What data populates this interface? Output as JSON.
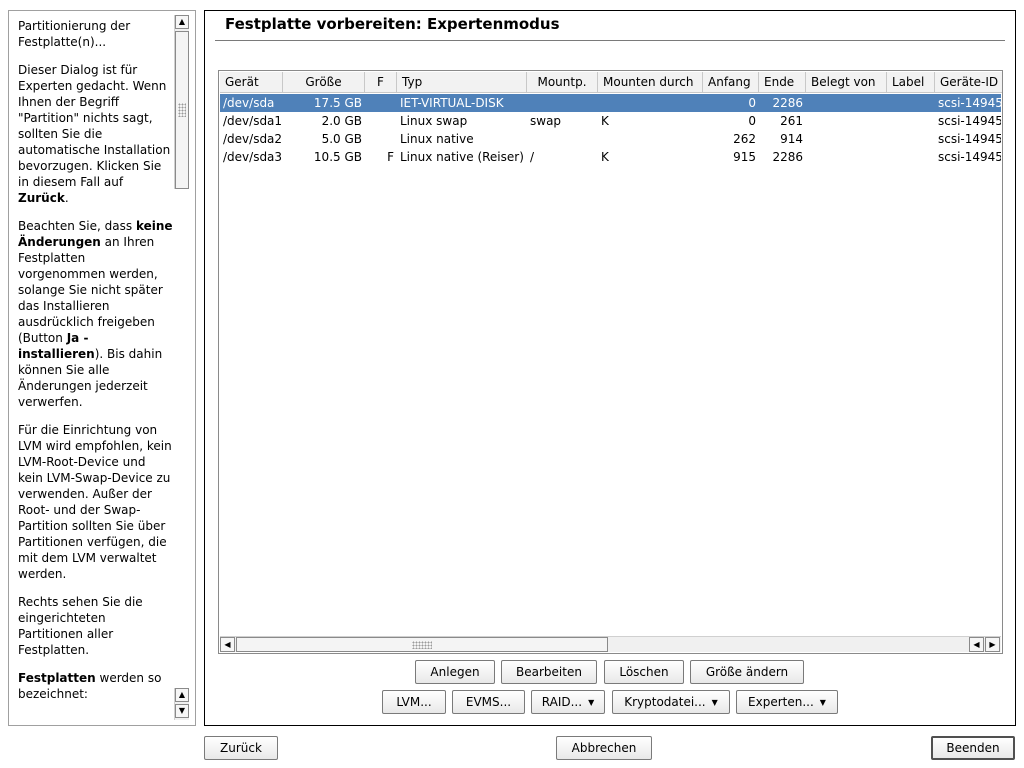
{
  "help": {
    "p1": "Partitionierung der Festplatte(n)...",
    "p2": "Dieser Dialog ist für Experten gedacht. Wenn Ihnen der Begriff \"Partition\" nichts sagt, sollten Sie die automatische Installation bevorzugen. Klicken Sie in diesem Fall auf ",
    "p2_bold": "Zurück",
    "p2_end": ".",
    "p3a": "Beachten Sie, dass ",
    "p3_bold1": "keine Änderungen",
    "p3b": " an Ihren Festplatten vorgenommen werden, solange Sie nicht später das Installieren ausdrücklich freigeben (Button ",
    "p3_bold2": "Ja - installieren",
    "p3c": "). Bis dahin können Sie alle Änderungen jederzeit verwerfen.",
    "p4": "Für die Einrichtung von LVM wird empfohlen, kein LVM-Root-Device und kein LVM-Swap-Device zu verwenden. Außer der Root- und der Swap-Partition sollten Sie über Partitionen verfügen, die mit dem LVM verwaltet werden.",
    "p5": "Rechts sehen Sie die eingerichteten Partitionen aller Festplatten.",
    "p6_bold": "Festplatten",
    "p6": " werden so bezeichnet:"
  },
  "main": {
    "title": "Festplatte vorbereiten: Expertenmodus"
  },
  "table": {
    "columns": [
      "Gerät",
      "Größe",
      "F",
      "Typ",
      "Mountp.",
      "Mounten durch",
      "Anfang",
      "Ende",
      "Belegt von",
      "Label",
      "Geräte-ID"
    ],
    "rows": [
      [
        "/dev/sda",
        "17.5 GB",
        "",
        "IET-VIRTUAL-DISK",
        "",
        "",
        "0",
        "2286",
        "",
        "",
        "scsi-14945"
      ],
      [
        "/dev/sda1",
        "2.0 GB",
        "",
        "Linux swap",
        "swap",
        "K",
        "0",
        "261",
        "",
        "",
        "scsi-14945"
      ],
      [
        "/dev/sda2",
        "5.0 GB",
        "",
        "Linux native",
        "",
        "",
        "262",
        "914",
        "",
        "",
        "scsi-14945"
      ],
      [
        "/dev/sda3",
        "10.5 GB",
        "F",
        "Linux native (Reiser)",
        "/",
        "K",
        "915",
        "2286",
        "",
        "",
        "scsi-14945"
      ]
    ],
    "selected_row": 0
  },
  "buttons": {
    "anlegen": "Anlegen",
    "bearbeiten": "Bearbeiten",
    "loeschen": "Löschen",
    "groesse": "Größe ändern",
    "lvm": "LVM...",
    "evms": "EVMS...",
    "raid": "RAID...",
    "krypto": "Kryptodatei...",
    "experten": "Experten...",
    "zurueck": "Zurück",
    "abbrechen": "Abbrechen",
    "beenden": "Beenden"
  },
  "icons": {
    "arrow_up": "▲",
    "arrow_down": "▼",
    "arrow_left": "◀",
    "arrow_right": "▶",
    "dropdown": "▼"
  },
  "colors": {
    "selection": "#4f81b9"
  }
}
